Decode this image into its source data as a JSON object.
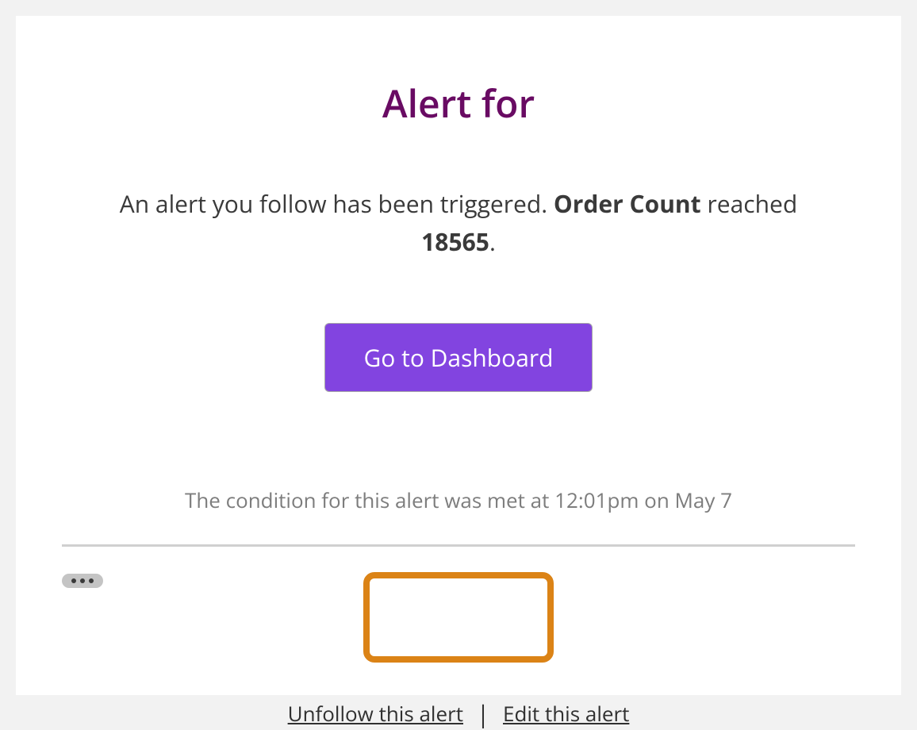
{
  "title": "Alert for",
  "message": {
    "prefix": "An alert you follow has been triggered. ",
    "metric": "Order Count",
    "mid": " reached ",
    "value": "18565",
    "suffix": "."
  },
  "button_label": "Go to Dashboard",
  "condition_text": "The condition for this alert was met at 12:01pm on May 7",
  "footer": {
    "unfollow": "Unfollow this alert",
    "separator": "|",
    "edit": "Edit this alert"
  }
}
